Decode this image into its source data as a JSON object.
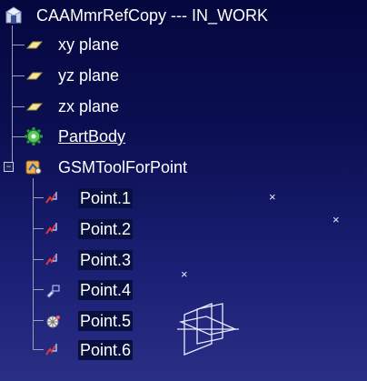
{
  "root": {
    "label": "CAAMmrRefCopy --- IN_WORK",
    "icon": "product-icon"
  },
  "planes": [
    {
      "label": "xy plane",
      "icon": "plane-icon"
    },
    {
      "label": "yz plane",
      "icon": "plane-icon"
    },
    {
      "label": "zx plane",
      "icon": "plane-icon"
    }
  ],
  "partbody": {
    "label": "PartBody",
    "icon": "partbody-gear-icon"
  },
  "tool": {
    "label": "GSMToolForPoint",
    "icon": "geometrical-set-icon",
    "expander": "−"
  },
  "points": [
    {
      "label": "Point.1",
      "icon": "point-icon"
    },
    {
      "label": "Point.2",
      "icon": "point-icon"
    },
    {
      "label": "Point.3",
      "icon": "point-icon"
    },
    {
      "label": "Point.4",
      "icon": "point-edit-icon"
    },
    {
      "label": "Point.5",
      "icon": "point-sphere-icon"
    },
    {
      "label": "Point.6",
      "icon": "point-icon"
    }
  ],
  "viewport": {
    "marker": "×",
    "axis_icon": "plane-axis-icon"
  },
  "colors": {
    "background_top": "#04073e",
    "background_bottom": "#2a2f86",
    "text": "#ffffff",
    "tree_line": "#9aa0b8"
  }
}
